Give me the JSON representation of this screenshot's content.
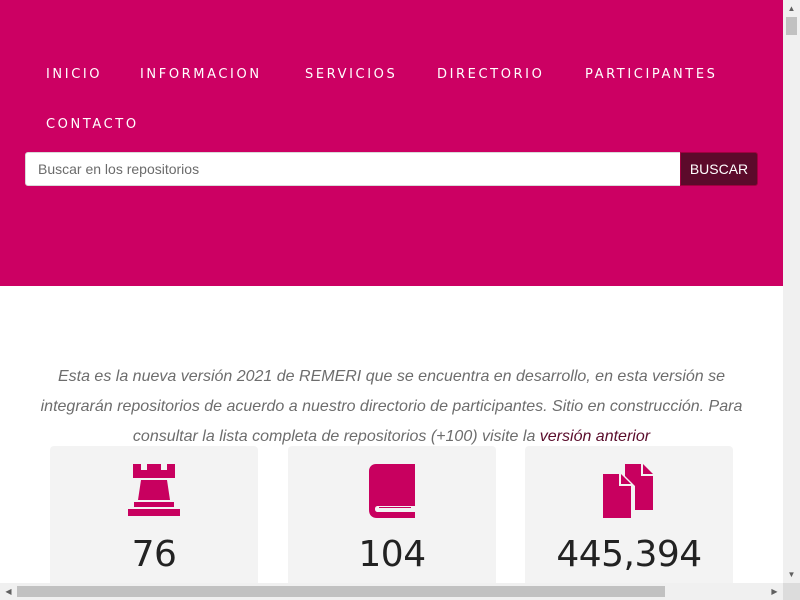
{
  "nav": {
    "items": [
      "INICIO",
      "INFORMACION",
      "SERVICIOS",
      "DIRECTORIO",
      "PARTICIPANTES",
      "CONTACTO"
    ]
  },
  "search": {
    "placeholder": "Buscar en los repositorios",
    "button_label": "BUSCAR"
  },
  "intro": {
    "text": "Esta es la nueva versión 2021 de REMERI que se encuentra en desarrollo, en esta versión se integrarán repositorios de acuerdo a nuestro directorio de participantes. Sitio en construcción. Para consultar la lista completa de repositorios (+100) visite la ",
    "link_text": "versión anterior"
  },
  "stats": [
    {
      "icon": "chess-rook-icon",
      "value": "76"
    },
    {
      "icon": "book-icon",
      "value": "104"
    },
    {
      "icon": "copy-documents-icon",
      "value": "445,394"
    }
  ],
  "colors": {
    "brand": "#cc0063",
    "button": "#5c0a2b",
    "icon": "#c8005f",
    "card": "#f3f3f3"
  }
}
